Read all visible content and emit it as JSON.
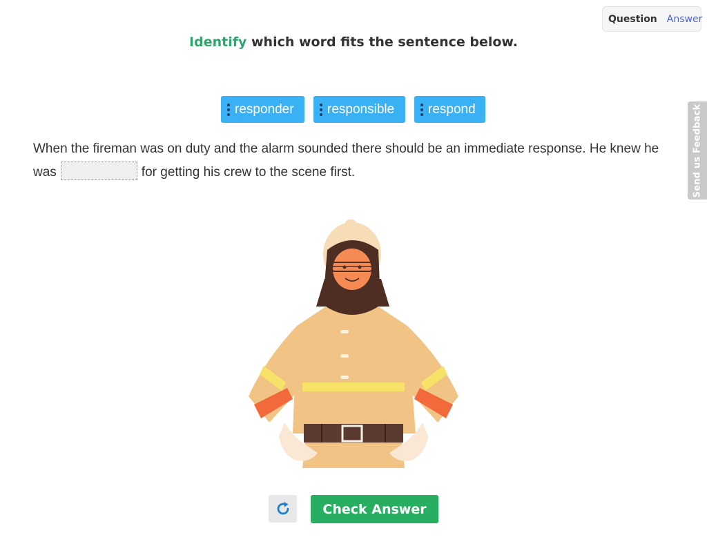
{
  "toggle": {
    "question_label": "Question",
    "answer_label": "Answer",
    "active": "Question"
  },
  "feedback_tab": {
    "label": "Send us Feedback"
  },
  "instruction": {
    "verb": "Identify",
    "rest": " which word fits the sentence below."
  },
  "word_bank": [
    {
      "label": "responder"
    },
    {
      "label": "responsible"
    },
    {
      "label": "respond"
    }
  ],
  "sentence": {
    "before": "When the fireman was on duty and the alarm sounded there should be an immediate response. He knew he was",
    "after": "for getting his crew to the scene first.",
    "blank_value": ""
  },
  "illustration": {
    "subject": "firefighter"
  },
  "icons": {
    "reset": "refresh-icon",
    "grip": "drag-handle-icon"
  },
  "buttons": {
    "check_label": "Check Answer"
  },
  "colors": {
    "accent_green": "#2ea66c",
    "chip_blue": "#3ab0f5",
    "check_green": "#27ae60",
    "answer_link": "#4a63d6"
  }
}
